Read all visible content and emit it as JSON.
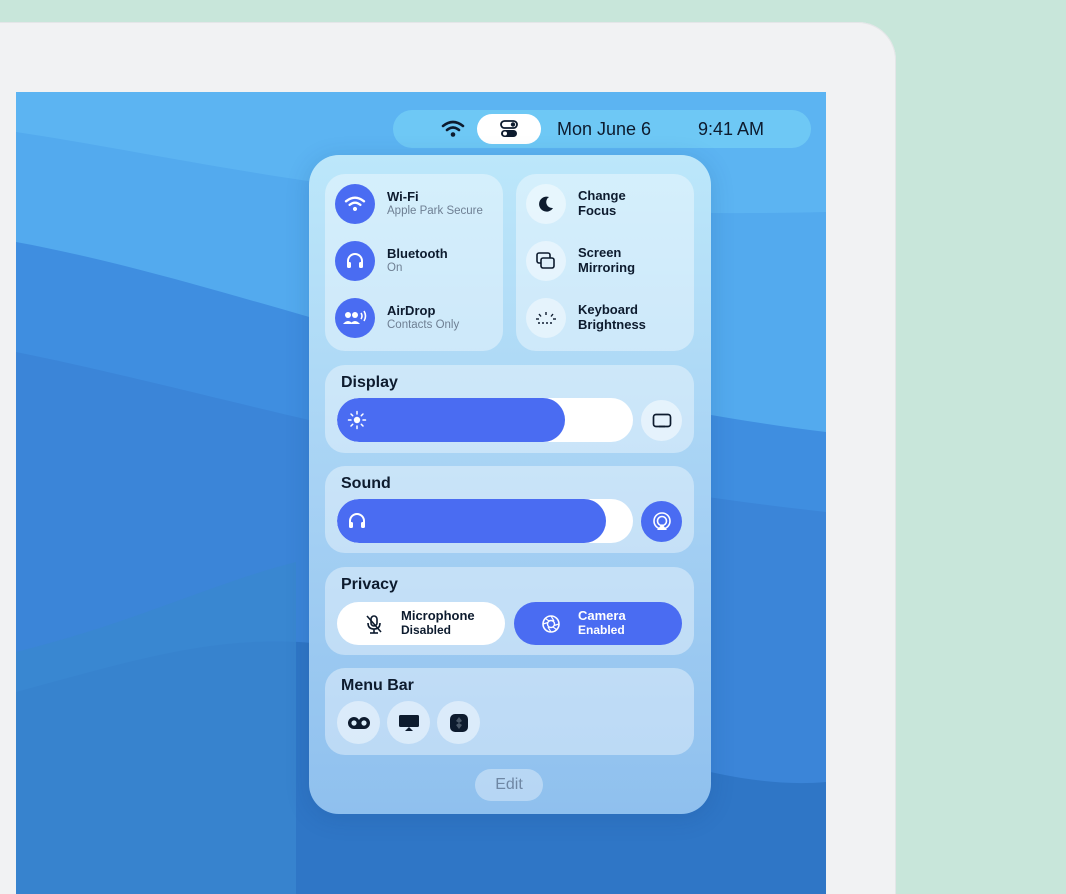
{
  "menubar": {
    "date": "Mon June 6",
    "time": "9:41 AM",
    "icons": [
      "wifi-icon",
      "control-center-icon"
    ]
  },
  "connectivity": [
    {
      "title": "Wi-Fi",
      "subtitle": "Apple Park Secure",
      "icon": "wifi-icon",
      "active": true
    },
    {
      "title": "Bluetooth",
      "subtitle": "On",
      "icon": "headphones-icon",
      "active": true
    },
    {
      "title": "AirDrop",
      "subtitle": "Contacts Only",
      "icon": "airdrop-icon",
      "active": true
    }
  ],
  "quick": [
    {
      "line1": "Change",
      "line2": "Focus",
      "icon": "moon-icon"
    },
    {
      "line1": "Screen",
      "line2": "Mirroring",
      "icon": "screen-mirroring-icon"
    },
    {
      "line1": "Keyboard",
      "line2": "Brightness",
      "icon": "keyboard-brightness-icon"
    }
  ],
  "display": {
    "title": "Display",
    "brightness_pct": 77
  },
  "sound": {
    "title": "Sound",
    "volume_pct": 91
  },
  "privacy": {
    "title": "Privacy",
    "microphone": {
      "name": "Microphone",
      "state": "Disabled"
    },
    "camera": {
      "name": "Camera",
      "state": "Enabled"
    }
  },
  "menu_bar_module": {
    "title": "Menu Bar",
    "icons": [
      "creative-cloud-icon",
      "apple-tv-icon",
      "app-icon"
    ]
  },
  "edit_label": "Edit",
  "colors": {
    "accent": "#4a6cf2",
    "menubar": "#6ec8f5",
    "background": "#c8e6da"
  }
}
